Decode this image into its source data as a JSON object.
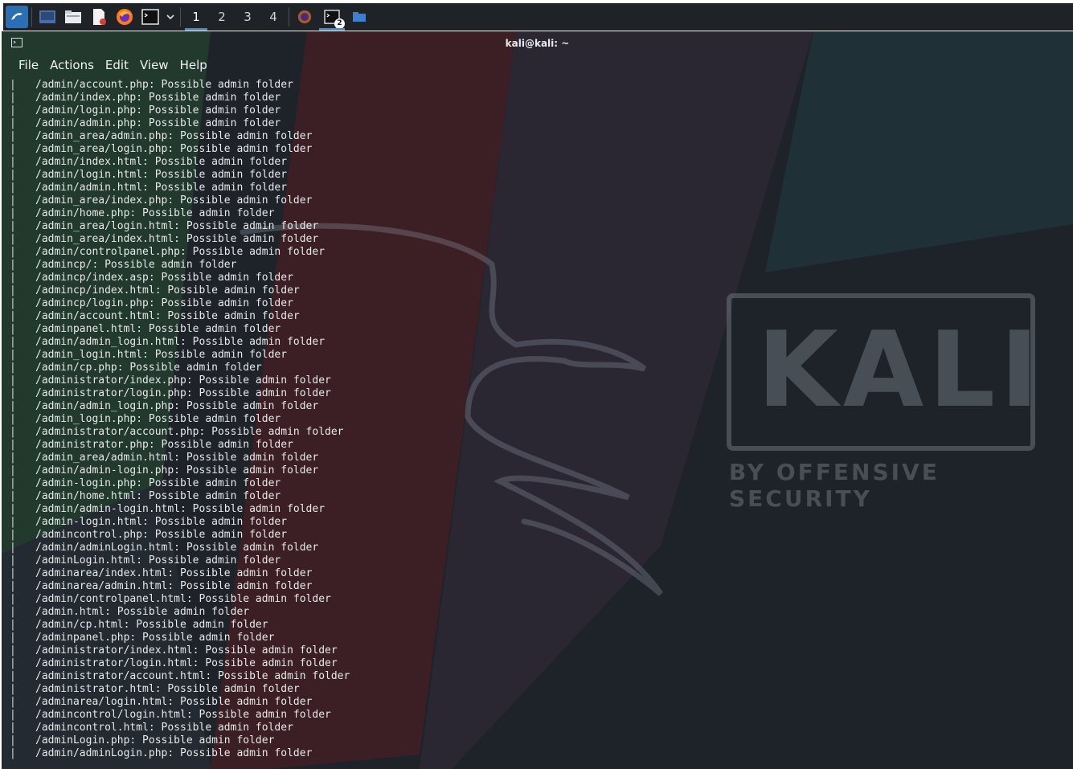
{
  "taskbar": {
    "workspaces": [
      "1",
      "2",
      "3",
      "4"
    ],
    "active_workspace": "1",
    "terminal_badge": "2",
    "accent_color": "#3d8fd6"
  },
  "window": {
    "title": "kali@kali: ~"
  },
  "menubar": {
    "items": [
      "File",
      "Actions",
      "Edit",
      "View",
      "Help"
    ]
  },
  "wallpaper": {
    "brand": "KALI",
    "tagline": "BY OFFENSIVE SECURITY"
  },
  "terminal": {
    "prefix": "|",
    "lines": [
      "/admin/account.php: Possible admin folder",
      "/admin/index.php: Possible admin folder",
      "/admin/login.php: Possible admin folder",
      "/admin/admin.php: Possible admin folder",
      "/admin_area/admin.php: Possible admin folder",
      "/admin_area/login.php: Possible admin folder",
      "/admin/index.html: Possible admin folder",
      "/admin/login.html: Possible admin folder",
      "/admin/admin.html: Possible admin folder",
      "/admin_area/index.php: Possible admin folder",
      "/admin/home.php: Possible admin folder",
      "/admin_area/login.html: Possible admin folder",
      "/admin_area/index.html: Possible admin folder",
      "/admin/controlpanel.php: Possible admin folder",
      "/admincp/: Possible admin folder",
      "/admincp/index.asp: Possible admin folder",
      "/admincp/index.html: Possible admin folder",
      "/admincp/login.php: Possible admin folder",
      "/admin/account.html: Possible admin folder",
      "/adminpanel.html: Possible admin folder",
      "/admin/admin_login.html: Possible admin folder",
      "/admin_login.html: Possible admin folder",
      "/admin/cp.php: Possible admin folder",
      "/administrator/index.php: Possible admin folder",
      "/administrator/login.php: Possible admin folder",
      "/admin/admin_login.php: Possible admin folder",
      "/admin_login.php: Possible admin folder",
      "/administrator/account.php: Possible admin folder",
      "/administrator.php: Possible admin folder",
      "/admin_area/admin.html: Possible admin folder",
      "/admin/admin-login.php: Possible admin folder",
      "/admin-login.php: Possible admin folder",
      "/admin/home.html: Possible admin folder",
      "/admin/admin-login.html: Possible admin folder",
      "/admin-login.html: Possible admin folder",
      "/admincontrol.php: Possible admin folder",
      "/admin/adminLogin.html: Possible admin folder",
      "/adminLogin.html: Possible admin folder",
      "/adminarea/index.html: Possible admin folder",
      "/adminarea/admin.html: Possible admin folder",
      "/admin/controlpanel.html: Possible admin folder",
      "/admin.html: Possible admin folder",
      "/admin/cp.html: Possible admin folder",
      "/adminpanel.php: Possible admin folder",
      "/administrator/index.html: Possible admin folder",
      "/administrator/login.html: Possible admin folder",
      "/administrator/account.html: Possible admin folder",
      "/administrator.html: Possible admin folder",
      "/adminarea/login.html: Possible admin folder",
      "/admincontrol/login.html: Possible admin folder",
      "/admincontrol.html: Possible admin folder",
      "/adminLogin.php: Possible admin folder",
      "/admin/adminLogin.php: Possible admin folder"
    ]
  }
}
